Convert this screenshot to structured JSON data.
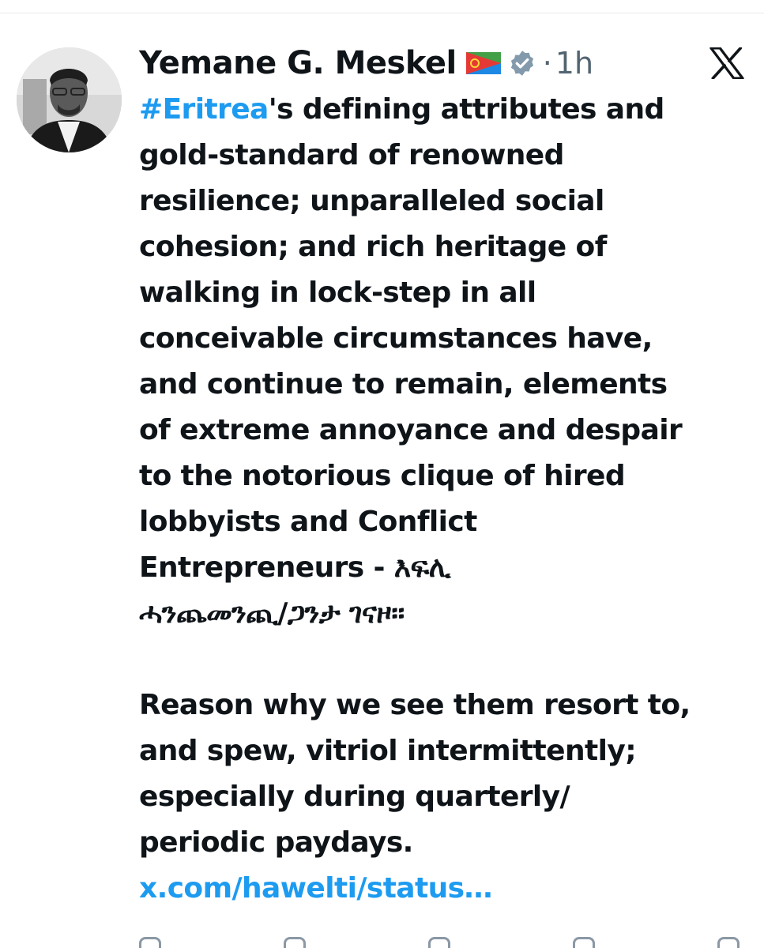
{
  "tweet": {
    "author": {
      "display_name": "Yemane G. Meskel",
      "avatar_icon": "avatar-photo",
      "flag_icon": "eritrea-flag-icon",
      "verified_icon": "verified-badge-icon"
    },
    "separator": "·",
    "time": "1h",
    "platform_logo": "x-logo-icon",
    "hashtag": "#Eritrea",
    "lines": [
      "'s defining attributes and",
      "gold-standard of renowned",
      "resilience; unparalleled social",
      "cohesion; and rich heritage of",
      "walking in lock-step in all",
      "conceivable circumstances have,",
      "and continue to remain, elements",
      "of extreme annoyance and despair",
      "to the notorious clique of hired",
      "lobbyists and Conflict",
      "Entrepreneurs - እፍሊ",
      "ሓንጨመንጪ/ጋንታ ገናዞ።"
    ],
    "lines_2": [
      "Reason why we see them resort to,",
      "and spew, vitriol intermittently;",
      "especially during quarterly/",
      "periodic paydays."
    ],
    "link": "x.com/hawelti/status…"
  },
  "colors": {
    "text": "#0f1419",
    "secondary": "#536471",
    "link": "#1d9bf0",
    "divider": "#e7e9ea"
  }
}
